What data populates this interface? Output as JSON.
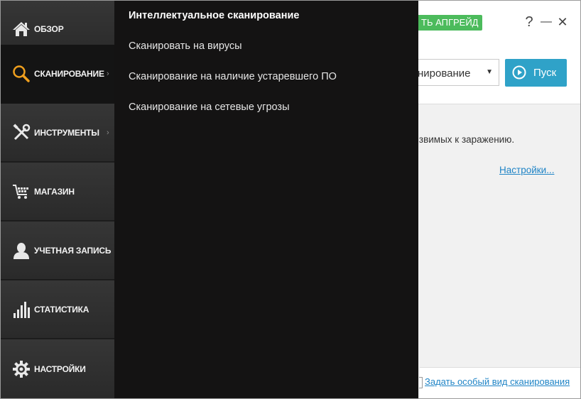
{
  "sidebar": {
    "items": [
      {
        "label": "ОБЗОР",
        "icon": "home-icon",
        "active": false,
        "has_submenu": false
      },
      {
        "label": "СКАНИРОВАНИЕ",
        "icon": "magnifier-icon",
        "active": true,
        "has_submenu": true
      },
      {
        "label": "ИНСТРУМЕНТЫ",
        "icon": "tools-icon",
        "active": false,
        "has_submenu": true
      },
      {
        "label": "МАГАЗИН",
        "icon": "cart-icon",
        "active": false,
        "has_submenu": false
      },
      {
        "label": "УЧЕТНАЯ ЗАПИСЬ",
        "icon": "user-icon",
        "active": false,
        "has_submenu": false
      },
      {
        "label": "СТАТИСТИКА",
        "icon": "bar-chart-icon",
        "active": false,
        "has_submenu": false
      },
      {
        "label": "НАСТРОЙКИ",
        "icon": "gear-icon",
        "active": false,
        "has_submenu": false
      }
    ],
    "chevron": "›"
  },
  "flyout": {
    "items": [
      "Интеллектуальное сканирование",
      "Сканировать на вирусы",
      "Сканирование на наличие устаревшего ПО",
      "Сканирование на сетевые угрозы"
    ]
  },
  "header": {
    "upgrade_label": "ТЬ АПГРЕЙД",
    "help": "?",
    "minimize": "—",
    "close": "✕"
  },
  "scan_bar": {
    "selected_value": "нирование",
    "start_label": "Пуск"
  },
  "content": {
    "text": "уязвимых к заражению.",
    "settings_link": "Настройки..."
  },
  "footer": {
    "custom_scan_link": "Задать особый вид сканирования"
  },
  "colors": {
    "sidebar_bg": "#2b2b2b",
    "flyout_bg": "#141313",
    "upgrade_green": "#4cbb5c",
    "start_blue": "#2fa2c8",
    "link_blue": "#1f84c6",
    "accent_orange": "#f0a01e"
  }
}
